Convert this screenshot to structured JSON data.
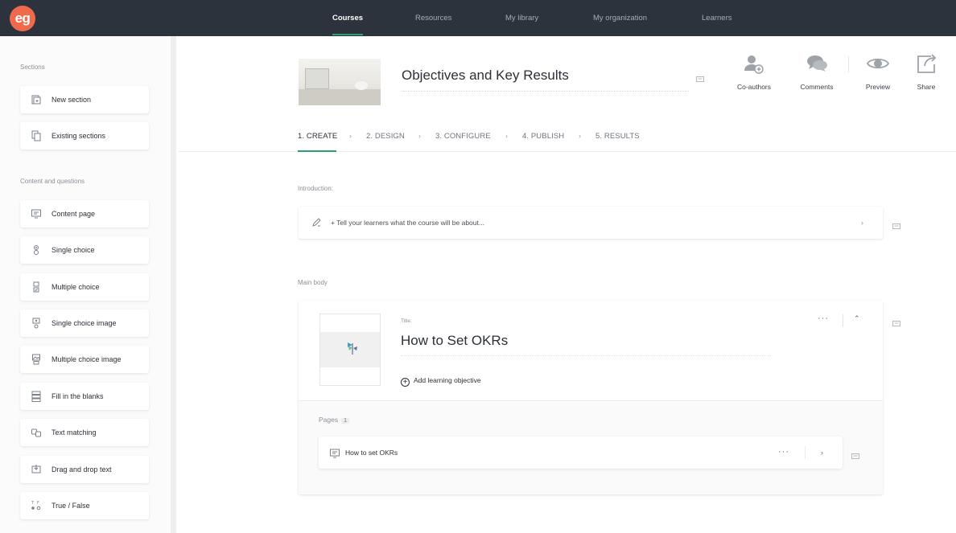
{
  "app": {
    "logo_text": "eg",
    "accent_color": "#2f9d6d",
    "brand_color": "#ef6a4c"
  },
  "nav": {
    "items": [
      {
        "label": "Courses",
        "active": true
      },
      {
        "label": "Resources"
      },
      {
        "label": "My library"
      },
      {
        "label": "My organization"
      },
      {
        "label": "Learners"
      }
    ]
  },
  "sidebar": {
    "sections_heading": "Sections",
    "sections": [
      {
        "label": "New section",
        "icon": "new-section-icon"
      },
      {
        "label": "Existing sections",
        "icon": "existing-sections-icon"
      }
    ],
    "content_heading": "Content and questions",
    "content_items": [
      {
        "label": "Content page",
        "icon": "content-page-icon"
      },
      {
        "label": "Single choice",
        "icon": "single-choice-icon"
      },
      {
        "label": "Multiple choice",
        "icon": "multiple-choice-icon"
      },
      {
        "label": "Single choice image",
        "icon": "single-choice-image-icon"
      },
      {
        "label": "Multiple choice image",
        "icon": "multiple-choice-image-icon"
      },
      {
        "label": "Fill in the blanks",
        "icon": "fill-blanks-icon"
      },
      {
        "label": "Text matching",
        "icon": "text-matching-icon"
      },
      {
        "label": "Drag and drop text",
        "icon": "drag-drop-icon"
      },
      {
        "label": "True / False",
        "icon": "true-false-icon"
      }
    ]
  },
  "course": {
    "title": "Objectives and Key Results"
  },
  "toolbar": {
    "coauthors": "Co-authors",
    "comments": "Comments",
    "preview": "Preview",
    "share": "Share"
  },
  "steps": [
    {
      "label": "1. CREATE",
      "active": true
    },
    {
      "label": "2. DESIGN"
    },
    {
      "label": "3. CONFIGURE"
    },
    {
      "label": "4. PUBLISH"
    },
    {
      "label": "5. RESULTS"
    }
  ],
  "introduction": {
    "label": "Introduction:",
    "placeholder": "+ Tell your learners what the course will be about..."
  },
  "main_body": {
    "label": "Main body",
    "title_small": "Title:",
    "lesson_title": "How to Set OKRs",
    "add_objective": "Add learning objective",
    "more_menu": "···",
    "pages_label": "Pages",
    "pages_count": "1",
    "pages": [
      {
        "label": "How to set OKRs"
      }
    ]
  }
}
